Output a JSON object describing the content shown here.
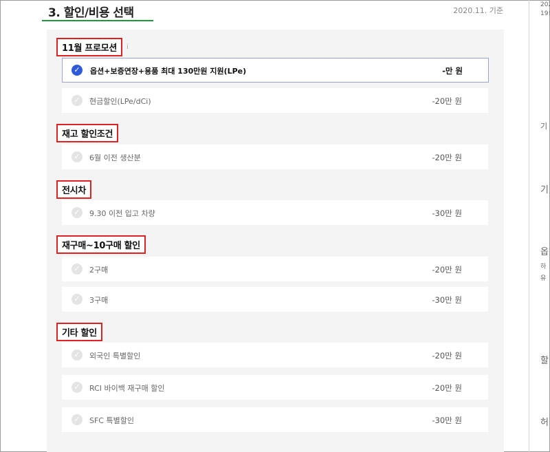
{
  "header": {
    "title": "3. 할인/비용 선택",
    "asof": "2020.11. 기준"
  },
  "sidebar_right": [
    "202",
    "19!",
    "기",
    "기",
    "옵",
    "하",
    "유",
    "할",
    "허"
  ],
  "sections": [
    {
      "title": "11월 프로모션",
      "info": "i",
      "items": [
        {
          "label": "옵션+보증연장+용품 최대 130만원 지원(LPe)",
          "amount": "-만 원",
          "selected": true
        },
        {
          "label": "현금할인(LPe/dCi)",
          "amount": "-20만 원",
          "selected": false
        }
      ]
    },
    {
      "title": "재고 할인조건",
      "items": [
        {
          "label": "6월 이전 생산분",
          "amount": "-20만 원",
          "selected": false
        }
      ]
    },
    {
      "title": "전시차",
      "items": [
        {
          "label": "9.30 이전 입고 차량",
          "amount": "-30만 원",
          "selected": false
        }
      ]
    },
    {
      "title": "재구매~10구매 할인",
      "items": [
        {
          "label": "2구매",
          "amount": "-20만 원",
          "selected": false
        },
        {
          "label": "3구매",
          "amount": "-30만 원",
          "selected": false
        }
      ]
    },
    {
      "title": "기타 할인",
      "items": [
        {
          "label": "외국인 특별할인",
          "amount": "-20만 원",
          "selected": false
        },
        {
          "label": "RCI 바이백 재구매 할인",
          "amount": "-20만 원",
          "selected": false
        },
        {
          "label": "SFC 특별할인",
          "amount": "-30만 원",
          "selected": false
        }
      ]
    }
  ],
  "colors": {
    "accent_green": "#1a9a3a",
    "check_selected": "#2f5bd8",
    "highlight_box": "#dd2222"
  }
}
